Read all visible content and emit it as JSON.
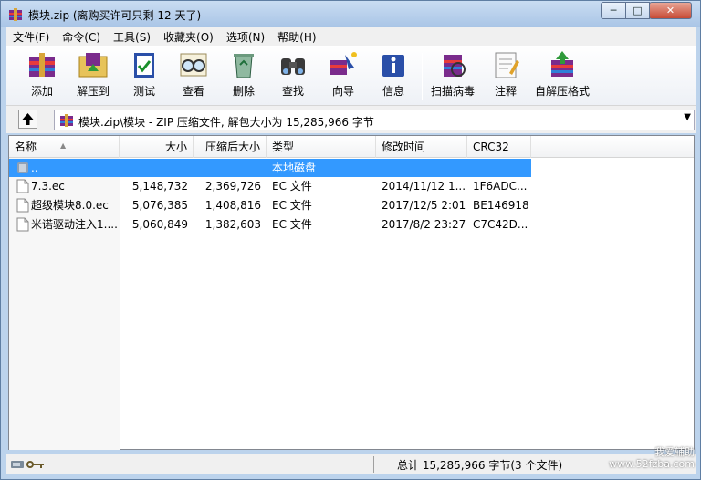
{
  "window": {
    "title": "模块.zip (离购买许可只剩 12 天了)",
    "controls": {
      "minimize": "─",
      "maximize": "□",
      "close": "✕"
    }
  },
  "menu": [
    "文件(F)",
    "命令(C)",
    "工具(S)",
    "收藏夹(O)",
    "选项(N)",
    "帮助(H)"
  ],
  "toolbar": [
    {
      "label": "添加",
      "icon": "add-books-icon"
    },
    {
      "label": "解压到",
      "icon": "extract-folder-icon"
    },
    {
      "label": "测试",
      "icon": "test-book-icon"
    },
    {
      "label": "查看",
      "icon": "view-glasses-icon"
    },
    {
      "label": "删除",
      "icon": "delete-recycle-icon"
    },
    {
      "label": "查找",
      "icon": "find-binoculars-icon"
    },
    {
      "label": "向导",
      "icon": "wizard-icon"
    },
    {
      "label": "信息",
      "icon": "info-icon"
    },
    {
      "label": "扫描病毒",
      "icon": "scan-virus-icon"
    },
    {
      "label": "注释",
      "icon": "comment-icon"
    },
    {
      "label": "自解压格式",
      "icon": "sfx-icon"
    }
  ],
  "address": {
    "path": "模块.zip\\模块 - ZIP 压缩文件, 解包大小为 15,285,966 字节",
    "dropdown": "▼"
  },
  "columns": [
    "名称",
    "大小",
    "压缩后大小",
    "类型",
    "修改时间",
    "CRC32"
  ],
  "sort_arrow": "▲",
  "rows": [
    {
      "name": "..",
      "size": "",
      "packed": "",
      "type": "本地磁盘",
      "modified": "",
      "crc": "",
      "selected": true
    },
    {
      "name": "7.3.ec",
      "size": "5,148,732",
      "packed": "2,369,726",
      "type": "EC 文件",
      "modified": "2014/11/12 1...",
      "crc": "1F6ADC..."
    },
    {
      "name": "超级模块8.0.ec",
      "size": "5,076,385",
      "packed": "1,408,816",
      "type": "EC 文件",
      "modified": "2017/12/5 2:01",
      "crc": "BE146918"
    },
    {
      "name": "米诺驱动注入1....",
      "size": "5,060,849",
      "packed": "1,382,603",
      "type": "EC 文件",
      "modified": "2017/8/2 23:27",
      "crc": "C7C42D..."
    }
  ],
  "status": {
    "summary": "总计 15,285,966 字节(3 个文件)"
  },
  "watermark": {
    "line1": "我爱辅助",
    "line2": "www.52fzba.com"
  },
  "colors": {
    "selection": "#3399ff",
    "window_frame": "#bcd3ec",
    "close_button": "#c74b36"
  }
}
